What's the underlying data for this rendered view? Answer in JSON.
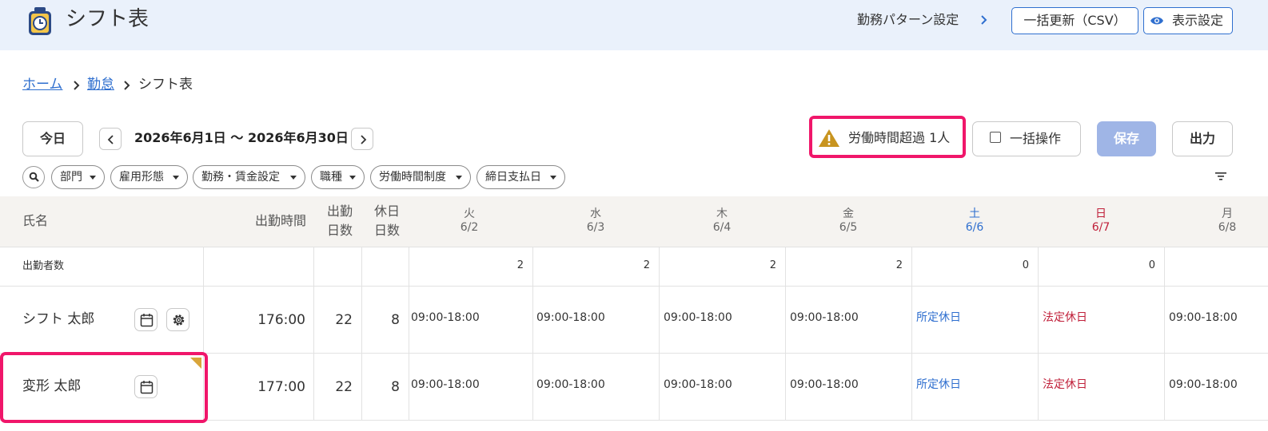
{
  "header": {
    "title": "シフト表",
    "pattern_link": "勤務パターン設定",
    "csv_button": "一括更新（CSV）",
    "view_button": "表示設定"
  },
  "breadcrumb": {
    "home": "ホーム",
    "attendance": "勤怠",
    "current": "シフト表"
  },
  "toolbar": {
    "today": "今日",
    "date_range": "2026年6月1日 〜 2026年6月30日",
    "alert": "労働時間超過 1人",
    "bulk": "一括操作",
    "save": "保存",
    "output": "出力"
  },
  "filters": [
    "部門",
    "雇用形態",
    "勤務・賃金設定",
    "職種",
    "労働時間制度",
    "締日支払日"
  ],
  "table": {
    "headers": {
      "name": "氏名",
      "hours": "出勤時間",
      "work_days_1": "出勤",
      "work_days_2": "日数",
      "off_days_1": "休日",
      "off_days_2": "日数"
    },
    "days": [
      {
        "weekday": "火",
        "date": "6/2"
      },
      {
        "weekday": "水",
        "date": "6/3"
      },
      {
        "weekday": "木",
        "date": "6/4"
      },
      {
        "weekday": "金",
        "date": "6/5"
      },
      {
        "weekday": "土",
        "date": "6/6"
      },
      {
        "weekday": "日",
        "date": "6/7"
      },
      {
        "weekday": "月",
        "date": "6/8"
      }
    ],
    "attendance_label": "出勤者数",
    "counts": [
      "2",
      "2",
      "2",
      "2",
      "0",
      "0"
    ],
    "rows": [
      {
        "name": "シフト 太郎",
        "hours": "176:00",
        "work_days": "22",
        "off_days": "8",
        "shifts": [
          "09:00-18:00",
          "09:00-18:00",
          "09:00-18:00",
          "09:00-18:00",
          "所定休日",
          "法定休日",
          "09:00-18:00"
        ]
      },
      {
        "name": "変形 太郎",
        "hours": "177:00",
        "work_days": "22",
        "off_days": "8",
        "shifts": [
          "09:00-18:00",
          "09:00-18:00",
          "09:00-18:00",
          "09:00-18:00",
          "所定休日",
          "法定休日",
          "09:00-18:00"
        ]
      }
    ]
  },
  "colors": {
    "header_bg": "#eaf1fb",
    "link_blue": "#2f6fcf",
    "saturday": "#2f6fcf",
    "sunday": "#c0203a",
    "highlight": "#f0166a",
    "save_disabled": "#9fb5e6",
    "warning": "#c8941f"
  },
  "icons": {
    "app": "clock-app-icon",
    "eye": "eye-icon",
    "warning": "warning-icon",
    "calendar": "calendar-icon",
    "settings": "gear-icon",
    "search": "search-icon",
    "sort": "filter-sort-icon"
  }
}
